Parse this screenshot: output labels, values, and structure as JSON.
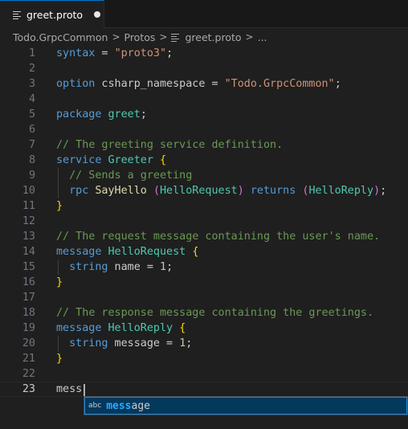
{
  "tab": {
    "label": "greet.proto",
    "icon": "file-lines-icon",
    "dirty": true
  },
  "breadcrumb": {
    "items": [
      "Todo.GrpcCommon",
      "Protos",
      "greet.proto",
      "..."
    ],
    "separator": ">"
  },
  "editor": {
    "active_line": 23,
    "lines": [
      {
        "n": "1",
        "tokens": [
          [
            "kw",
            "syntax"
          ],
          [
            "id",
            " = "
          ],
          [
            "str",
            "\"proto3\""
          ],
          [
            "id",
            ";"
          ]
        ]
      },
      {
        "n": "2",
        "tokens": []
      },
      {
        "n": "3",
        "tokens": [
          [
            "kw",
            "option"
          ],
          [
            "id",
            " csharp_namespace = "
          ],
          [
            "str",
            "\"Todo.GrpcCommon\""
          ],
          [
            "id",
            ";"
          ]
        ]
      },
      {
        "n": "4",
        "tokens": []
      },
      {
        "n": "5",
        "tokens": [
          [
            "kw",
            "package"
          ],
          [
            "id",
            " "
          ],
          [
            "type",
            "greet"
          ],
          [
            "id",
            ";"
          ]
        ]
      },
      {
        "n": "6",
        "tokens": []
      },
      {
        "n": "7",
        "tokens": [
          [
            "com",
            "// The greeting service definition."
          ]
        ]
      },
      {
        "n": "8",
        "tokens": [
          [
            "kw",
            "service"
          ],
          [
            "id",
            " "
          ],
          [
            "type",
            "Greeter"
          ],
          [
            "id",
            " "
          ],
          [
            "brace",
            "{"
          ]
        ]
      },
      {
        "n": "9",
        "guide": true,
        "tokens": [
          [
            "id",
            "  "
          ],
          [
            "com",
            "// Sends a greeting"
          ]
        ]
      },
      {
        "n": "10",
        "guide": true,
        "tokens": [
          [
            "id",
            "  "
          ],
          [
            "kw",
            "rpc"
          ],
          [
            "id",
            " "
          ],
          [
            "fn",
            "SayHello"
          ],
          [
            "id",
            " "
          ],
          [
            "paren",
            "("
          ],
          [
            "type",
            "HelloRequest"
          ],
          [
            "paren",
            ")"
          ],
          [
            "id",
            " "
          ],
          [
            "kw",
            "returns"
          ],
          [
            "id",
            " "
          ],
          [
            "paren",
            "("
          ],
          [
            "type",
            "HelloReply"
          ],
          [
            "paren",
            ")"
          ],
          [
            "id",
            ";"
          ]
        ]
      },
      {
        "n": "11",
        "tokens": [
          [
            "brace",
            "}"
          ]
        ]
      },
      {
        "n": "12",
        "tokens": []
      },
      {
        "n": "13",
        "tokens": [
          [
            "com",
            "// The request message containing the user's name."
          ]
        ]
      },
      {
        "n": "14",
        "tokens": [
          [
            "kw",
            "message"
          ],
          [
            "id",
            " "
          ],
          [
            "type",
            "HelloRequest"
          ],
          [
            "id",
            " "
          ],
          [
            "brace",
            "{"
          ]
        ]
      },
      {
        "n": "15",
        "guide": true,
        "tokens": [
          [
            "id",
            "  "
          ],
          [
            "kw",
            "string"
          ],
          [
            "id",
            " name = "
          ],
          [
            "num",
            "1"
          ],
          [
            "id",
            ";"
          ]
        ]
      },
      {
        "n": "16",
        "tokens": [
          [
            "brace",
            "}"
          ]
        ]
      },
      {
        "n": "17",
        "tokens": []
      },
      {
        "n": "18",
        "tokens": [
          [
            "com",
            "// The response message containing the greetings."
          ]
        ]
      },
      {
        "n": "19",
        "tokens": [
          [
            "kw",
            "message"
          ],
          [
            "id",
            " "
          ],
          [
            "type",
            "HelloReply"
          ],
          [
            "id",
            " "
          ],
          [
            "brace",
            "{"
          ]
        ]
      },
      {
        "n": "20",
        "guide": true,
        "tokens": [
          [
            "id",
            "  "
          ],
          [
            "kw",
            "string"
          ],
          [
            "id",
            " message = "
          ],
          [
            "num",
            "1"
          ],
          [
            "id",
            ";"
          ]
        ]
      },
      {
        "n": "21",
        "tokens": [
          [
            "brace",
            "}"
          ]
        ]
      },
      {
        "n": "22",
        "tokens": []
      },
      {
        "n": "23",
        "tokens": [
          [
            "id",
            "mess"
          ]
        ]
      }
    ]
  },
  "suggest": {
    "kind_label": "abc",
    "match": "mess",
    "rest": "age"
  },
  "colors": {
    "keyword": "#569cd6",
    "string": "#ce9178",
    "type": "#4ec9b0",
    "function": "#dcdcaa",
    "comment": "#6a9955",
    "number": "#b5cea8",
    "accent": "#0078d4"
  }
}
